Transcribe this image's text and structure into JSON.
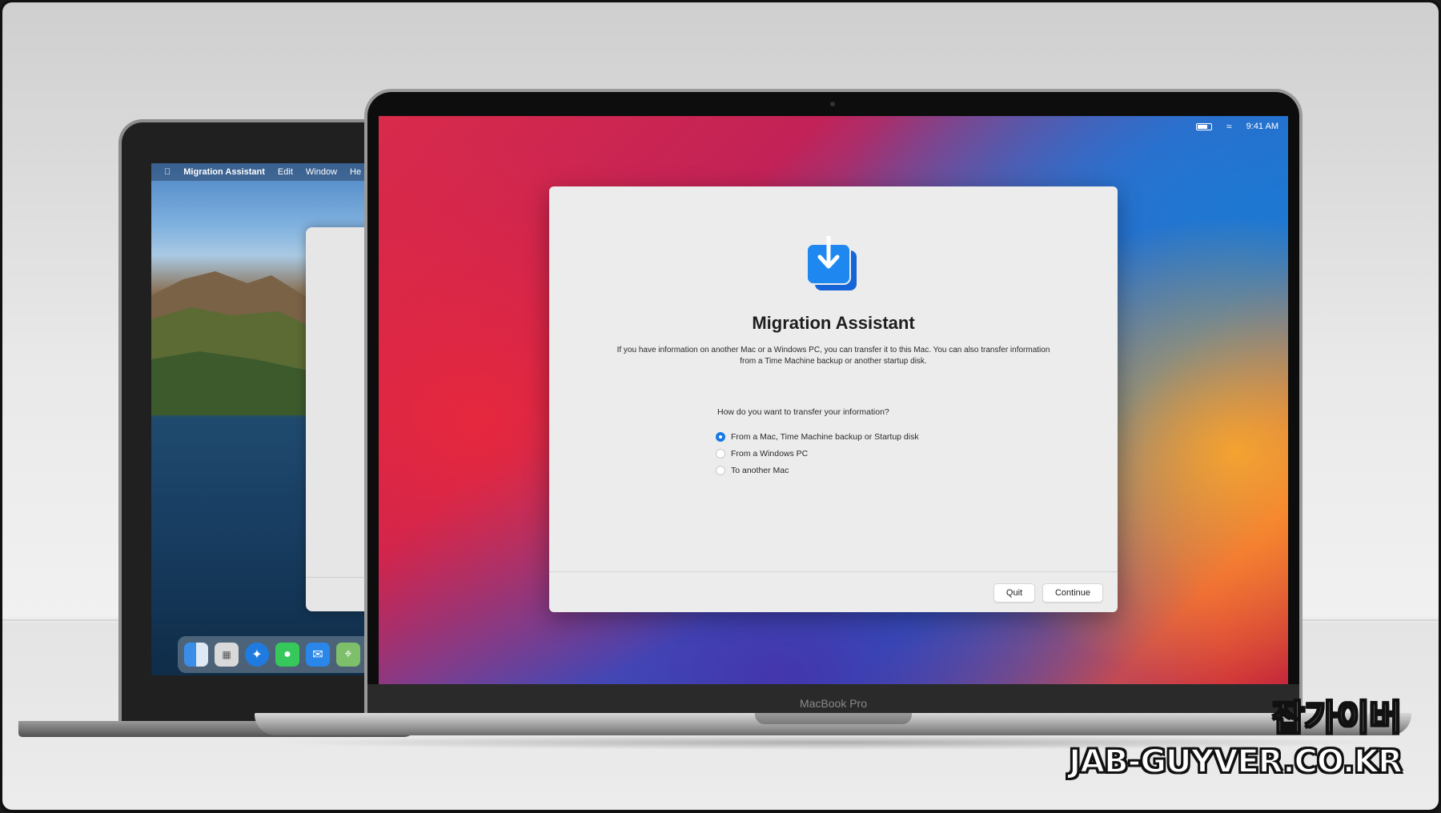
{
  "back_laptop": {
    "menubar": {
      "apple_icon": "apple-logo-icon",
      "app_name": "Migration Assistant",
      "items": [
        "Edit",
        "Window",
        "He"
      ]
    },
    "dock_icons": [
      "finder-icon",
      "launchpad-icon",
      "safari-icon",
      "messages-icon",
      "mail-icon",
      "maps-icon"
    ]
  },
  "front_laptop": {
    "menubar": {
      "battery_icon": "battery-icon",
      "wifi_icon": "wifi-icon",
      "time": "9:41 AM"
    },
    "dialog": {
      "icon": "migration-assistant-icon",
      "title": "Migration Assistant",
      "description": "If you have information on another Mac or a Windows PC, you can transfer it to this Mac. You can also transfer information from a Time Machine backup or another startup disk.",
      "question": "How do you want to transfer your information?",
      "options": [
        {
          "label": "From a Mac, Time Machine backup or Startup disk",
          "selected": true
        },
        {
          "label": "From a Windows PC",
          "selected": false
        },
        {
          "label": "To another Mac",
          "selected": false
        }
      ],
      "buttons": {
        "quit": "Quit",
        "continue": "Continue"
      }
    },
    "model_label": "MacBook Pro"
  },
  "watermark": {
    "korean": "잡가이버",
    "site": "JAB-GUYVER.CO.KR"
  },
  "colors": {
    "accent_blue": "#1778e6",
    "dialog_bg": "#ececec"
  }
}
